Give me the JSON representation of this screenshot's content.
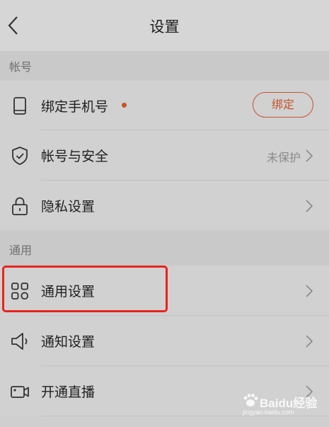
{
  "header": {
    "title": "设置"
  },
  "sections": [
    {
      "label": "帐号",
      "items": [
        {
          "label": "绑定手机号",
          "icon": "phone-icon",
          "button_label": "绑定",
          "has_dot": true
        },
        {
          "label": "帐号与安全",
          "icon": "shield-icon",
          "value": "未保护"
        },
        {
          "label": "隐私设置",
          "icon": "lock-icon"
        }
      ]
    },
    {
      "label": "通用",
      "items": [
        {
          "label": "通用设置",
          "icon": "grid-icon"
        },
        {
          "label": "通知设置",
          "icon": "speaker-icon"
        },
        {
          "label": "开通直播",
          "icon": "video-camera-icon"
        }
      ]
    }
  ],
  "colors": {
    "accent": "#c5532c",
    "highlight": "#e8231d"
  },
  "watermark": {
    "text": "Baidu经验",
    "sub": "jingyan.baidu.com"
  }
}
